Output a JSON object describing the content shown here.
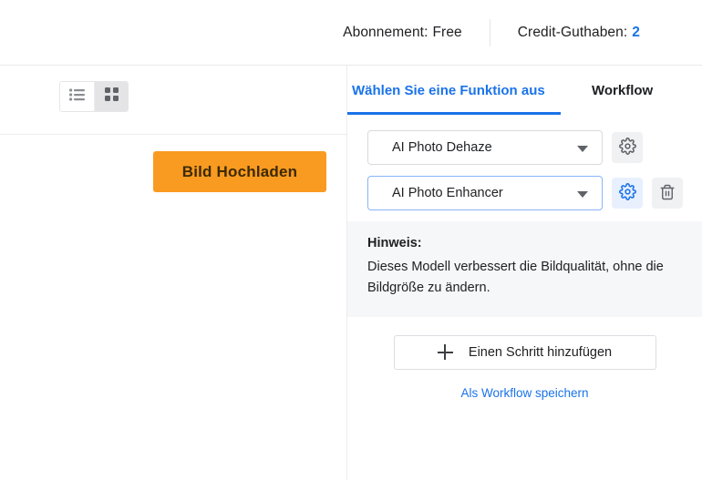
{
  "header": {
    "subscription_label": "Abonnement:",
    "subscription_value": "Free",
    "credits_label": "Credit-Guthaben:",
    "credits_value": "2",
    "accent_color": "#1a73e8"
  },
  "left_toolbar": {
    "list_view_name": "list-view",
    "grid_view_name": "grid-view",
    "upload_label": "Bild Hochladen",
    "upload_color": "#f99b20",
    "upload_text_color": "#3d2a05"
  },
  "right_panel": {
    "tabs": [
      {
        "label": "Wählen Sie eine Funktion aus",
        "active": true
      },
      {
        "label": "Workflow",
        "active": false
      }
    ],
    "steps": [
      {
        "value": "AI Photo Dehaze",
        "focused": false,
        "has_settings": true,
        "settings_active": false,
        "has_delete": false
      },
      {
        "value": "AI Photo Enhancer",
        "focused": true,
        "has_settings": true,
        "settings_active": true,
        "has_delete": true
      }
    ],
    "hint": {
      "title": "Hinweis:",
      "body": "Dieses Modell verbessert die Bildqualität, ohne die Bildgröße zu ändern."
    },
    "add_step_label": "Einen Schritt hinzufügen",
    "save_workflow_label": "Als Workflow speichern"
  }
}
